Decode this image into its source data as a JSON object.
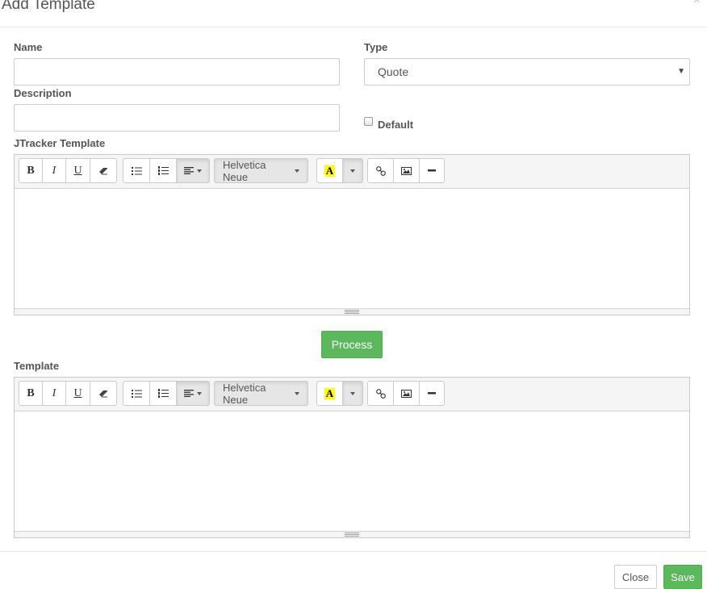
{
  "modal": {
    "title": "Add Template",
    "close_glyph": "×"
  },
  "form": {
    "name_label": "Name",
    "name_value": "",
    "type_label": "Type",
    "type_selected": "Quote",
    "description_label": "Description",
    "description_value": "",
    "default_label": "Default",
    "default_checked": false,
    "jtracker_label": "JTracker Template",
    "template_label": "Template"
  },
  "toolbar": {
    "bold": "B",
    "italic": "I",
    "underline": "U",
    "font_name": "Helvetica Neue",
    "color_letter": "A",
    "icons": [
      "bold-icon",
      "italic-icon",
      "underline-icon",
      "eraser-icon",
      "unordered-list-icon",
      "ordered-list-icon",
      "align-icon",
      "font-color-icon",
      "link-icon",
      "picture-icon",
      "horizontal-rule-icon"
    ]
  },
  "actions": {
    "process": "Process",
    "close": "Close",
    "save": "Save"
  },
  "colors": {
    "success": "#5cb85c",
    "highlight": "#ffff00",
    "border": "#cccccc"
  }
}
